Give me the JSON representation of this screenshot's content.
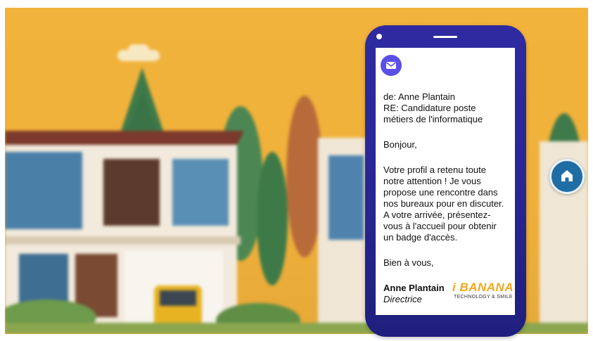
{
  "email": {
    "from": "de: Anne Plantain",
    "subject_line1": "RE: Candidature poste",
    "subject_line2": "métiers de l'informatique",
    "greeting": "Bonjour,",
    "body_lines": [
      "Votre profil a retenu toute",
      "notre attention ! Je vous",
      "propose une rencontre dans",
      "nos bureaux pour en discuter.",
      "A votre arrivée, présentez-",
      "vous à l'accueil pour obtenir",
      "un badge d'accès."
    ],
    "closing": "Bien à vous,",
    "signature_name": "Anne Plantain",
    "signature_role": "Directrice"
  },
  "logo": {
    "main": "i BANANA",
    "tagline": "TECHNOLOGY & SMILE"
  },
  "icons": {
    "mail": "envelope-icon",
    "home": "home-icon"
  },
  "colors": {
    "sky": "#f1b33b",
    "phone": "#2a2796",
    "mail_icon_bg": "#5a4fe6",
    "home_button": "#1f6da5",
    "logo": "#f3a81c"
  }
}
